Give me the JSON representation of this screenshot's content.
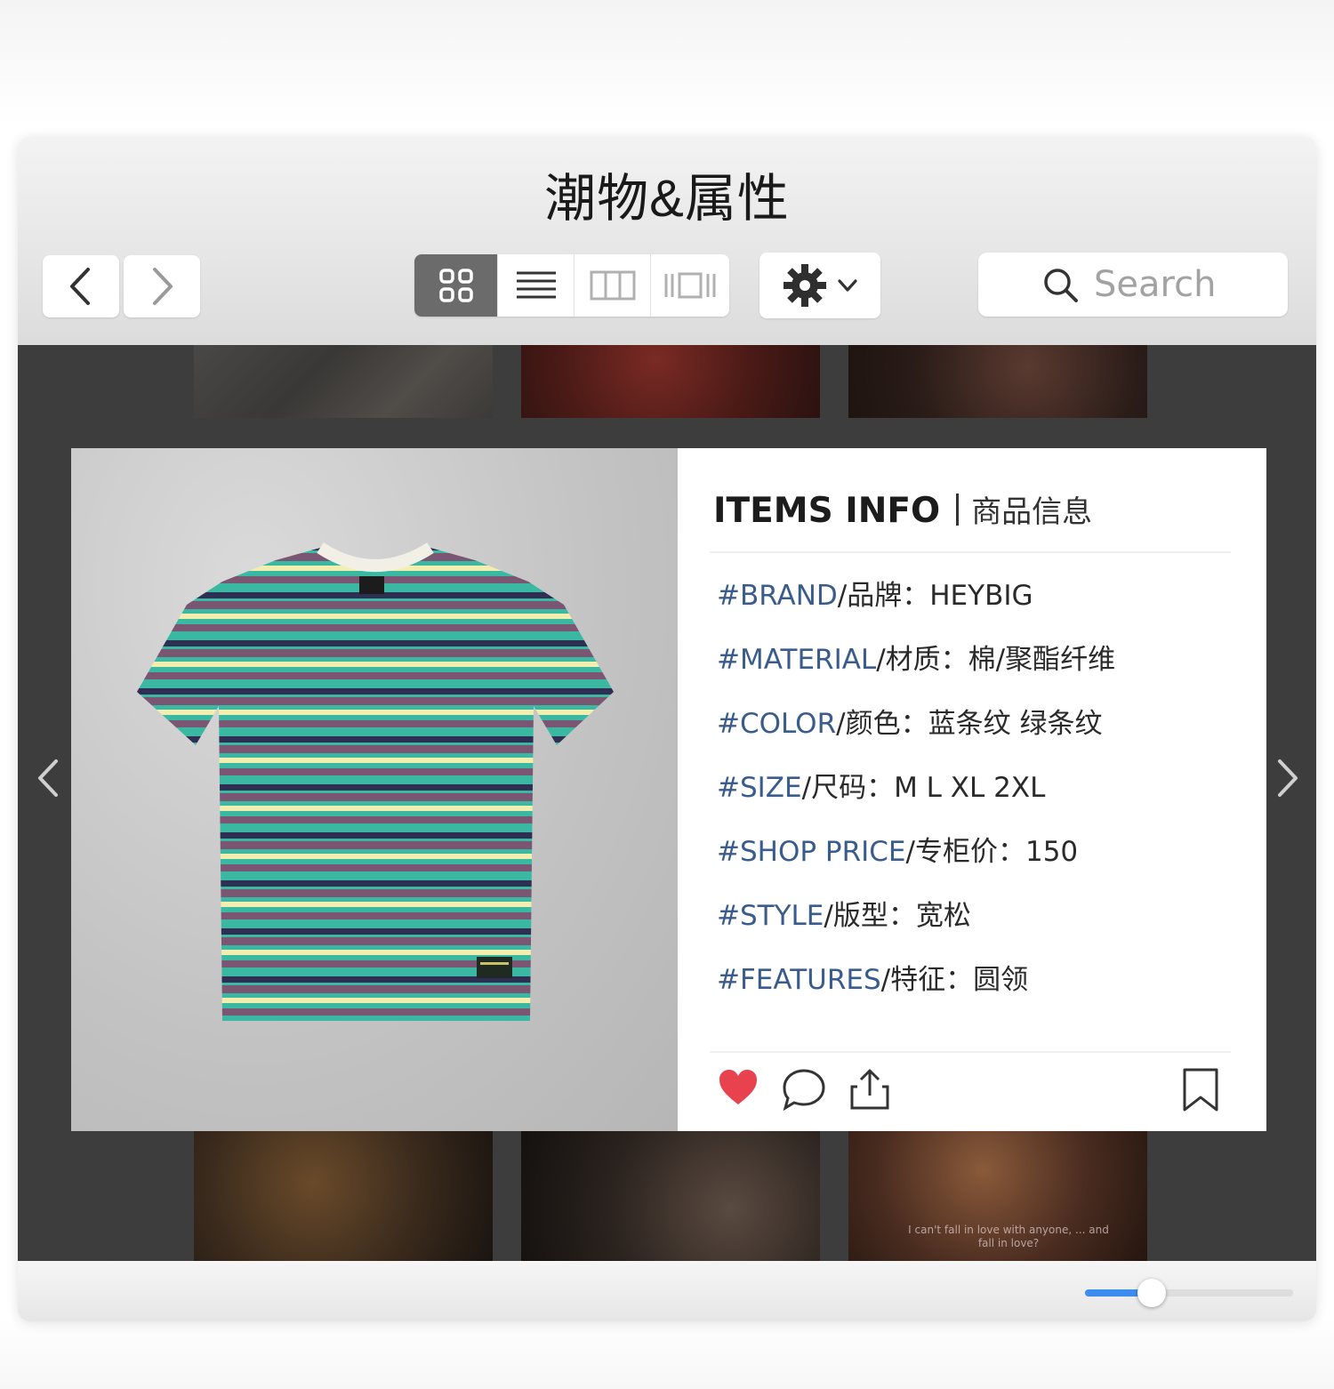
{
  "window": {
    "title": "潮物&属性"
  },
  "toolbar": {
    "back_icon": "chevron-left-icon",
    "forward_icon": "chevron-right-icon",
    "view_modes": [
      {
        "name": "grid-view-icon",
        "active": true
      },
      {
        "name": "list-view-icon",
        "active": false
      },
      {
        "name": "column-view-icon",
        "active": false
      },
      {
        "name": "coverflow-view-icon",
        "active": false
      }
    ],
    "action_icon": "gear-icon",
    "search_placeholder": "Search"
  },
  "gallery": {
    "top_thumbnails": 3,
    "bottom_thumbnails": 3,
    "caption": "I can't fall in love with anyone, ... and fall in love?"
  },
  "item_card": {
    "title_en": "ITEMS INFO",
    "title_zh": "商品信息",
    "attributes": [
      {
        "key": "#BRAND",
        "label": "/品牌：HEYBIG"
      },
      {
        "key": "#MATERIAL",
        "label": "/材质：棉/聚酯纤维"
      },
      {
        "key": "#COLOR",
        "label": "/颜色：蓝条纹 绿条纹"
      },
      {
        "key": "#SIZE",
        "label": "/尺码：M L XL 2XL"
      },
      {
        "key": "#SHOP PRICE",
        "label": "/专柜价：150"
      },
      {
        "key": "#STYLE",
        "label": "/版型：宽松"
      },
      {
        "key": "#FEATURES",
        "label": "/特征：圆领"
      }
    ],
    "actions": [
      "heart-icon",
      "comment-icon",
      "share-icon",
      "bookmark-icon"
    ],
    "colors": {
      "key": "#3a5c8c",
      "heart": "#e8424e"
    }
  },
  "zoom": {
    "value": 0.32
  }
}
